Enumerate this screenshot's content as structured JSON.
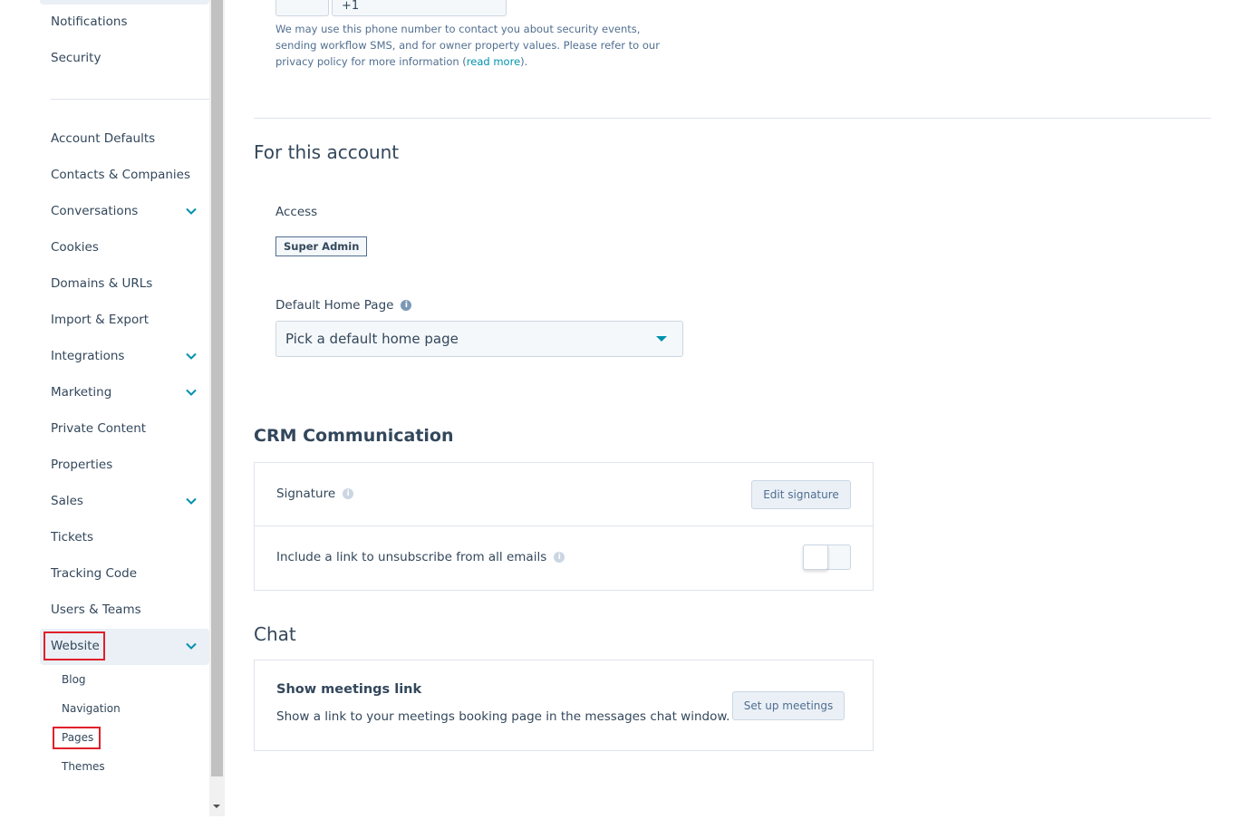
{
  "sidebar": {
    "top_items": [
      {
        "label": "Notifications"
      },
      {
        "label": "Security"
      }
    ],
    "items": [
      {
        "label": "Account Defaults",
        "expandable": false
      },
      {
        "label": "Contacts & Companies",
        "expandable": false
      },
      {
        "label": "Conversations",
        "expandable": true
      },
      {
        "label": "Cookies",
        "expandable": false
      },
      {
        "label": "Domains & URLs",
        "expandable": false
      },
      {
        "label": "Import & Export",
        "expandable": false
      },
      {
        "label": "Integrations",
        "expandable": true
      },
      {
        "label": "Marketing",
        "expandable": true
      },
      {
        "label": "Private Content",
        "expandable": false
      },
      {
        "label": "Properties",
        "expandable": false
      },
      {
        "label": "Sales",
        "expandable": true
      },
      {
        "label": "Tickets",
        "expandable": false
      },
      {
        "label": "Tracking Code",
        "expandable": false
      },
      {
        "label": "Users & Teams",
        "expandable": false
      },
      {
        "label": "Website",
        "expandable": true,
        "active": true
      }
    ],
    "sub_items": [
      {
        "label": "Blog"
      },
      {
        "label": "Navigation"
      },
      {
        "label": "Pages"
      },
      {
        "label": "Themes"
      }
    ]
  },
  "phone": {
    "code": "+1",
    "note_text": "We may use this phone number to contact you about security events, sending workflow SMS, and for owner property values. Please refer to our privacy policy for more information (",
    "read_more": "read more",
    "note_end": ")."
  },
  "account": {
    "title": "For this account",
    "access_label": "Access",
    "access_badge": "Super Admin",
    "home_label": "Default Home Page",
    "home_placeholder": "Pick a default home page"
  },
  "crm": {
    "title": "CRM Communication",
    "signature_label": "Signature",
    "edit_signature": "Edit signature",
    "unsubscribe_label": "Include a link to unsubscribe from all emails",
    "unsubscribe_on": false
  },
  "chat": {
    "title": "Chat",
    "meetings_title": "Show meetings link",
    "meetings_desc": "Show a link to your meetings booking page in the messages chat window.",
    "setup_button": "Set up meetings"
  },
  "colors": {
    "accent": "#0091ae",
    "highlight": "#e0202a",
    "text": "#33475b"
  }
}
